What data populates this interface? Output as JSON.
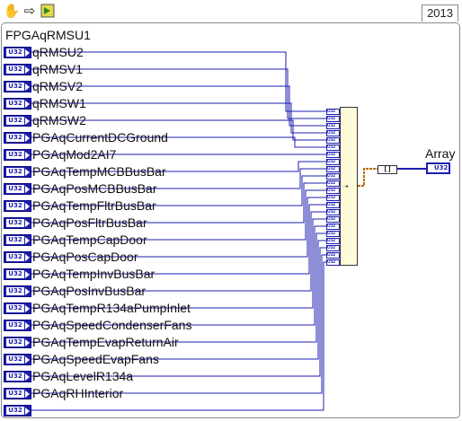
{
  "toolbar": {
    "run_icon": "hand-icon",
    "highlight_icon": "highlight-arrow-icon",
    "step_icon": "retain-wire-values-icon"
  },
  "version": "2013",
  "cluster": {
    "title": "FPGAqRMSU1",
    "dtype": "U32",
    "items": [
      "qRMSU2",
      "qRMSV1",
      "qRMSV2",
      "qRMSW1",
      "qRMSW2",
      "PGAqCurrentDCGround",
      "PGAqMod2AI7",
      "PGAqTempMCBBusBar",
      "PGAqPosMCBBusBar",
      "PGAqTempFltrBusBar",
      "PGAqPosFltrBusBar",
      "PGAqTempCapDoor",
      "PGAqPosCapDoor",
      "PGAqTempInvBusBar",
      "PGAqPosInvBusBar",
      "PGAqTempR134aPumpInlet",
      "PGAqSpeedCondenserFans",
      "PGAqTempEvapReturnAir",
      "PGAqSpeedEvapFans",
      "PGAqLevelR134a",
      "PGAqRHInterior",
      ""
    ]
  },
  "output": {
    "label": "Array",
    "dtype": "U32"
  },
  "colors": {
    "wire": "#1c1cb0",
    "conv_wire": "#b36b00",
    "node_fill": "#fffbd8"
  }
}
